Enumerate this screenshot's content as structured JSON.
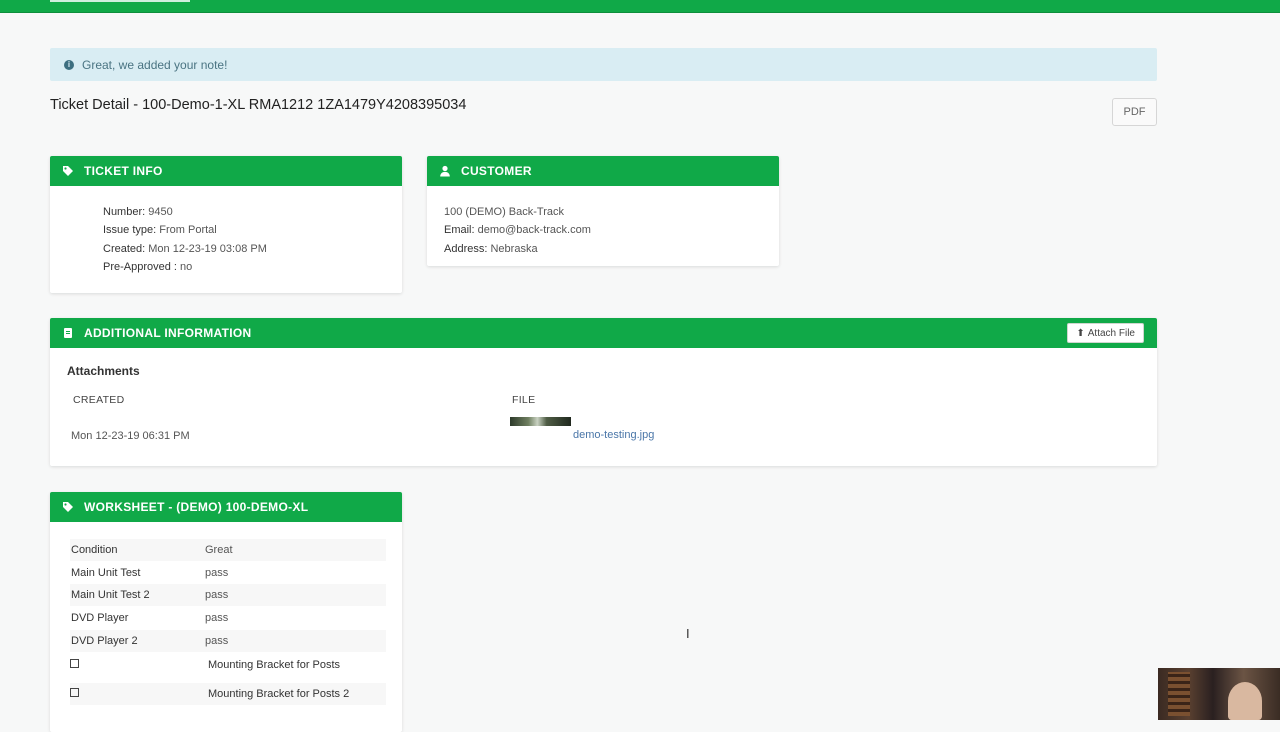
{
  "alert": {
    "message": "Great, we added your note!"
  },
  "page": {
    "title": "Ticket Detail - 100-Demo-1-XL RMA1212 1ZA1479Y4208395034",
    "pdf_label": "PDF"
  },
  "ticket_info": {
    "header": "TICKET INFO",
    "number_label": "Number:",
    "number": "9450",
    "issue_label": "Issue type:",
    "issue": "From Portal",
    "created_label": "Created:",
    "created": "Mon 12-23-19 03:08 PM",
    "preapproved_label": "Pre-Approved :",
    "preapproved": "no"
  },
  "customer": {
    "header": "CUSTOMER",
    "name": "100 (DEMO) Back-Track",
    "email_label": "Email:",
    "email": "demo@back-track.com",
    "address_label": "Address:",
    "address": "Nebraska"
  },
  "additional": {
    "header": "ADDITIONAL INFORMATION",
    "attach_label": "Attach File",
    "attachments_title": "Attachments",
    "col_created": "CREATED",
    "col_file": "FILE",
    "rows": [
      {
        "created": "Mon 12-23-19 06:31 PM",
        "file": "demo-testing.jpg"
      }
    ]
  },
  "worksheet": {
    "header": "WORKSHEET - (DEMO) 100-DEMO-XL",
    "rows": [
      {
        "label": "Condition",
        "value": "Great"
      },
      {
        "label": "Main Unit Test",
        "value": "pass"
      },
      {
        "label": "Main Unit Test 2",
        "value": "pass"
      },
      {
        "label": "DVD Player",
        "value": "pass"
      },
      {
        "label": "DVD Player 2",
        "value": "pass"
      }
    ],
    "checks": [
      {
        "label": "Mounting Bracket for Posts"
      },
      {
        "label": "Mounting Bracket for Posts 2"
      }
    ]
  },
  "colors": {
    "accent": "#10a948",
    "alert_bg": "#d9edf3",
    "link": "#4a76a8"
  },
  "icons": [
    "info-circle-icon",
    "tag-icon",
    "user-icon",
    "book-icon",
    "upload-icon",
    "checkbox-icon"
  ]
}
